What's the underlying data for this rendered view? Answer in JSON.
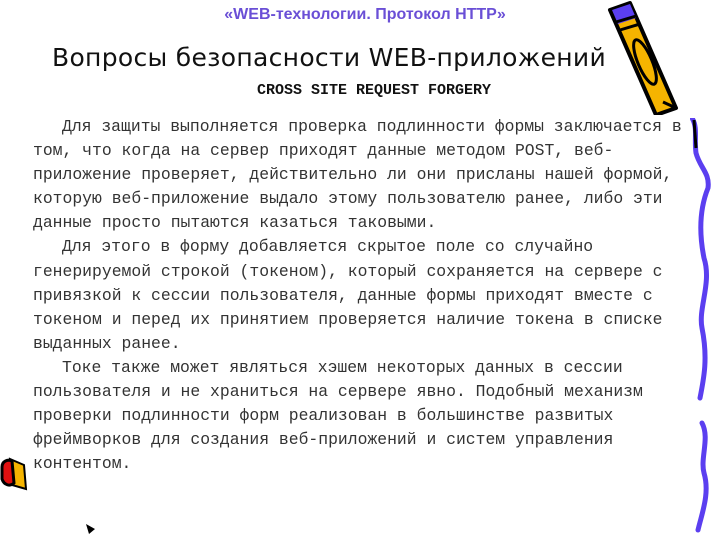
{
  "header": {
    "subtitle": "«WEB-технологии. Протокол HTTP»",
    "title": "Вопросы безопасности WEB-приложений",
    "section_heading": "CROSS SITE REQUEST FORGERY"
  },
  "body": {
    "paragraphs": [
      "Для защиты выполняется проверка подлинности формы заключается в том, что когда на сервер приходят данные методом POST, веб-приложение проверяет, действительно ли они присланы нашей формой, которую веб-приложение выдало этому пользователю ранее, либо эти данные просто пытаются казаться таковыми.",
      "Для этого в форму добавляется скрытое поле со случайно генерируемой строкой (токеном), который сохраняется на сервере с привязкой к сессии пользователя, данные формы приходят вместе с токеном и перед их принятием проверяется наличие токена в списке выданных ранее.",
      "Токе также может являться хэшем некоторых данных в сессии пользователя и не храниться на сервере явно. Подобный механизм проверки подлинности форм реализован в большинстве развитых фреймворков для создания веб-приложений и систем управления контентом."
    ]
  },
  "decorations": {
    "icons": [
      "pencil-icon",
      "squiggle-line-icon",
      "eraser-icon",
      "pencil-tip-icon"
    ],
    "colors": {
      "accent_purple": "#6a4fd6",
      "pencil_yellow": "#f5b400",
      "squiggle_blue": "#5b3ff0",
      "eraser_red": "#e01010"
    }
  }
}
